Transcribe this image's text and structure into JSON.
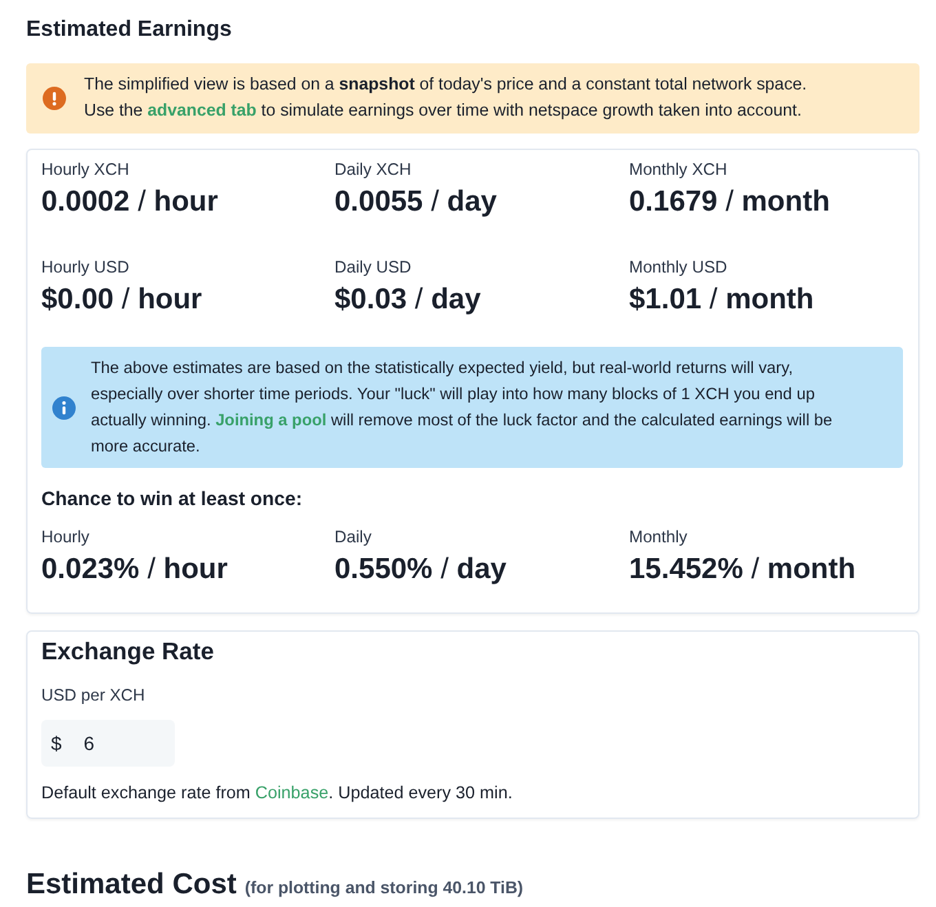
{
  "title": "Estimated Earnings",
  "notice": {
    "kind": "warning",
    "paragraphs": [
      [
        {
          "kind": "text",
          "text": "The simplified view is based on a **snapshot** of today's price and a constant total network space."
        }
      ],
      [
        {
          "kind": "text",
          "text": "Use the "
        },
        {
          "kind": "link",
          "text": "advanced tab"
        },
        {
          "kind": "text",
          "text": " to simulate earnings over time with netspace growth taken into account."
        }
      ]
    ]
  },
  "earnings": {
    "stats": [
      {
        "label": "Hourly XCH",
        "value": "**0.0002** / **hour**"
      },
      {
        "label": "Daily XCH",
        "value": "**0.0055** / **day**"
      },
      {
        "label": "Monthly XCH",
        "value": "**0.1679** / **month**"
      },
      {
        "label": "Hourly USD",
        "value": "**$0.00** / **hour**"
      },
      {
        "label": "Daily USD",
        "value": "**$0.03** / **day**"
      },
      {
        "label": "Monthly USD",
        "value": "**$1.01** / **month**"
      }
    ],
    "notice": {
      "kind": "info",
      "paragraphs": [
        [
          {
            "kind": "text",
            "text": "The above estimates are based on the statistically expected yield, but real-world returns will vary, especially over shorter time periods. Your \"luck\" will play into how many blocks of 1 XCH you end up actually winning. "
          },
          {
            "kind": "link",
            "text": "Joining a pool"
          },
          {
            "kind": "text",
            "text": " will remove most of the luck factor and the calculated earnings will be more accurate."
          }
        ]
      ]
    },
    "chance": {
      "heading": "Chance to win at least once:",
      "stats": [
        {
          "label": "Hourly",
          "value": "**0.023%** / **hour**"
        },
        {
          "label": "Daily",
          "value": "**0.550%** / **day**"
        },
        {
          "label": "Monthly",
          "value": "**15.452%** / **month**"
        }
      ]
    }
  },
  "exchange_rate": {
    "title": "Exchange Rate",
    "field_label": "USD per XCH",
    "prefix": "$",
    "value": "6",
    "note": [
      {
        "kind": "text",
        "text": "Default exchange rate from "
      },
      {
        "kind": "link",
        "text": "Coinbase"
      },
      {
        "kind": "text",
        "text": ". Updated every 30 min."
      }
    ]
  },
  "cost": {
    "title": "Estimated Cost",
    "subtitle": "(for plotting and storing 40.10 TiB)"
  }
}
